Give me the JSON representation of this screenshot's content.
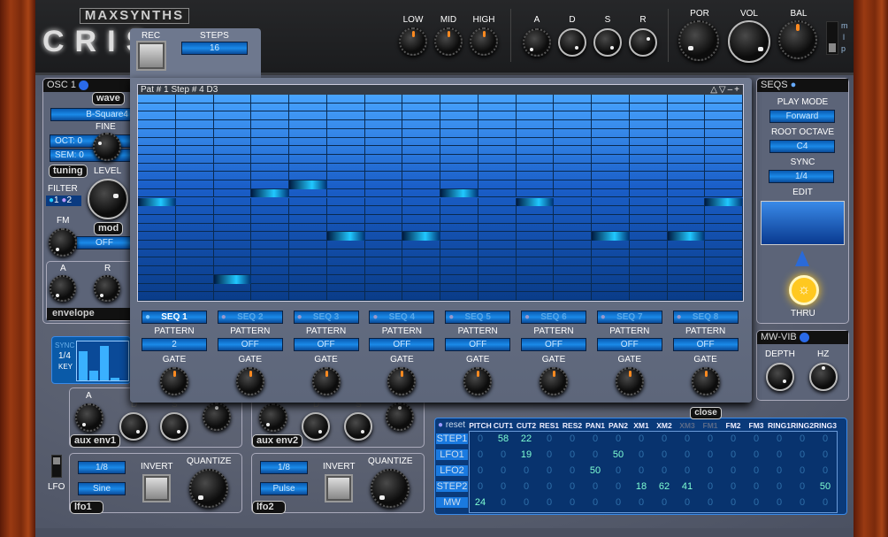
{
  "brand": {
    "logo": "MAXSYNTHS",
    "product": "CRIS"
  },
  "eq": {
    "low": "LOW",
    "mid": "MID",
    "high": "HIGH"
  },
  "amp_env": {
    "a": "A",
    "d": "D",
    "s": "S",
    "r": "R"
  },
  "master": {
    "por": "POR",
    "vol": "VOL",
    "bal": "BAL",
    "switch_labels": [
      "m",
      "l",
      "p"
    ]
  },
  "osc1": {
    "title": "OSC 1",
    "wave_btn": "wave",
    "wave_value": "B-Square4",
    "fine": "FINE",
    "oct": "OCT:  0",
    "sem": "SEM:  0",
    "tuning_btn": "tuning",
    "level": "LEVEL",
    "filter": "FILTER",
    "filter_opts": [
      "1",
      "2"
    ],
    "fm": "FM",
    "mod_btn": "mod",
    "mod_value": "OFF",
    "env_a": "A",
    "env_r": "R",
    "envelope": "envelope"
  },
  "lfo_sync": {
    "sync": "SYNC",
    "rate": "1/4",
    "key": "KEY"
  },
  "aux_env1": {
    "title": "aux env1",
    "a": "A",
    "d": "D",
    "s": "S"
  },
  "aux_env2": {
    "title": "aux env2",
    "d": "D",
    "s": "S"
  },
  "lfo_switch": "LFO",
  "lfo1": {
    "title": "lfo1",
    "rate": "1/8",
    "shape": "Sine",
    "invert": "INVERT",
    "quantize": "QUANTIZE"
  },
  "lfo2": {
    "title": "lfo2",
    "rate": "1/8",
    "shape": "Pulse",
    "invert": "INVERT",
    "quantize": "QUANTIZE"
  },
  "sequencer": {
    "rec": "REC",
    "steps_label": "STEPS",
    "steps": "16",
    "status": "Pat # 1 Step # 4  D3",
    "grid_controls": [
      "△",
      "▽",
      "–",
      "+"
    ],
    "grid": {
      "rows": 24,
      "steps": 16,
      "notes": [
        {
          "step": 1,
          "row": 12
        },
        {
          "step": 3,
          "row": 21
        },
        {
          "step": 4,
          "row": 11
        },
        {
          "step": 5,
          "row": 10
        },
        {
          "step": 6,
          "row": 16
        },
        {
          "step": 8,
          "row": 16
        },
        {
          "step": 9,
          "row": 11
        },
        {
          "step": 11,
          "row": 12
        },
        {
          "step": 13,
          "row": 16
        },
        {
          "step": 15,
          "row": 16
        },
        {
          "step": 16,
          "row": 12
        }
      ]
    },
    "seqs": [
      {
        "name": "SEQ 1",
        "pattern": "2",
        "active": true
      },
      {
        "name": "SEQ 2",
        "pattern": "OFF",
        "active": false
      },
      {
        "name": "SEQ 3",
        "pattern": "OFF",
        "active": false
      },
      {
        "name": "SEQ 4",
        "pattern": "OFF",
        "active": false
      },
      {
        "name": "SEQ 5",
        "pattern": "OFF",
        "active": false
      },
      {
        "name": "SEQ 6",
        "pattern": "OFF",
        "active": false
      },
      {
        "name": "SEQ 7",
        "pattern": "OFF",
        "active": false
      },
      {
        "name": "SEQ 8",
        "pattern": "OFF",
        "active": false
      }
    ],
    "pattern_label": "PATTERN",
    "gate_label": "GATE",
    "close": "close"
  },
  "seqs_panel": {
    "title": "SEQS",
    "play_mode_label": "PLAY MODE",
    "play_mode": "Forward",
    "root_octave_label": "ROOT OCTAVE",
    "root_octave": "C4",
    "sync_label": "SYNC",
    "sync": "1/4",
    "edit": "EDIT",
    "thru": "THRU"
  },
  "mw_vib": {
    "title": "MW-VIB",
    "depth": "DEPTH",
    "hz": "HZ"
  },
  "matrix": {
    "reset": "reset",
    "columns": [
      "PITCH",
      "CUT1",
      "CUT2",
      "RES1",
      "RES2",
      "PAN1",
      "PAN2",
      "XM1",
      "XM2",
      "XM3",
      "FM1",
      "FM2",
      "FM3",
      "RING1",
      "RING2",
      "RING3"
    ],
    "rows": [
      {
        "label": "STEP1",
        "values": [
          0,
          58,
          22,
          0,
          0,
          0,
          0,
          0,
          0,
          0,
          0,
          0,
          0,
          0,
          0,
          0
        ]
      },
      {
        "label": "LFO1",
        "values": [
          0,
          0,
          19,
          0,
          0,
          0,
          50,
          0,
          0,
          0,
          0,
          0,
          0,
          0,
          0,
          0
        ]
      },
      {
        "label": "LFO2",
        "values": [
          0,
          0,
          0,
          0,
          0,
          50,
          0,
          0,
          0,
          0,
          0,
          0,
          0,
          0,
          0,
          0
        ]
      },
      {
        "label": "STEP2",
        "values": [
          0,
          0,
          0,
          0,
          0,
          0,
          0,
          18,
          62,
          41,
          0,
          0,
          0,
          0,
          0,
          50
        ]
      },
      {
        "label": "MW",
        "values": [
          24,
          0,
          0,
          0,
          0,
          0,
          0,
          0,
          0,
          0,
          0,
          0,
          0,
          0,
          0,
          0
        ]
      }
    ]
  },
  "colors": {
    "accent": "#1a8ae8",
    "note": "#20c8ff",
    "nonzero": "#7fffd4",
    "zero": "#2f6ea8",
    "gate_indicator": "#ff8a20",
    "thru": "#ffc820"
  }
}
